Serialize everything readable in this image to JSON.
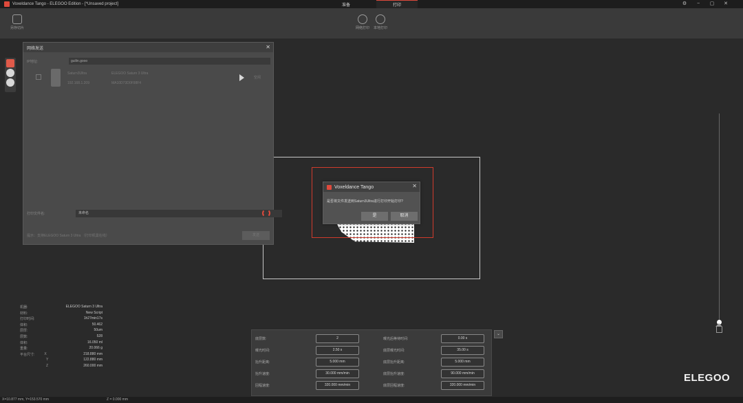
{
  "window": {
    "title": "Voxeldance Tango - ELEGOO Edition - [*Unsaved project]",
    "tabs": [
      {
        "label": "准备",
        "active": false
      },
      {
        "label": "打印",
        "active": true
      }
    ]
  },
  "toolbar": {
    "left_btn": {
      "label": "另存切片",
      "icon": "save-slice-icon"
    },
    "center_btns": [
      {
        "label": "网络打印",
        "icon": "network-print-icon"
      },
      {
        "label": "本地打印",
        "icon": "local-print-icon"
      }
    ]
  },
  "network_dialog": {
    "title": "网络发送",
    "ip_label": "IP地址:",
    "ip_value": "guilin.gooo",
    "device": {
      "name": "Saturn3Ultra",
      "model": "ELEGOO Saturn 3 Ultra",
      "ip": "192.168.1.209",
      "id": "MA10D73D0F98F4",
      "status": "空闲"
    },
    "file_label": "打印文件名:",
    "file_value": "未命名",
    "footnote": "提示：支持ELEGOO Saturn 3 Ultra   （打印机需在线）",
    "send_label": "发送"
  },
  "message_box": {
    "title": "Voxeldance Tango",
    "text": "是否将文件发送到Saturn3Ultra进行打印开始打印?",
    "yes_label": "是",
    "cancel_label": "取消"
  },
  "print_info": [
    {
      "label": "机器:",
      "value": "ELEGOO Saturn 3 Ultra"
    },
    {
      "label": "材料:",
      "value": "New Script"
    },
    {
      "label": "打印时间:",
      "value": "1h27min17s"
    },
    {
      "label": "体积:",
      "value": "50.462"
    },
    {
      "label": "层厚:",
      "value": "50um"
    },
    {
      "label": "层数:",
      "value": "528"
    },
    {
      "label": "体积:",
      "value": "16.050 ml"
    },
    {
      "label": "重量:",
      "value": "20.066 g"
    }
  ],
  "model_size": {
    "label": "平台尺寸:",
    "x": {
      "axis": "X",
      "value": "218.880 mm"
    },
    "y": {
      "axis": "Y",
      "value": "122.880 mm"
    },
    "z": {
      "axis": "Z",
      "value": "260.000 mm"
    }
  },
  "params": {
    "left": [
      {
        "label": "底层数:",
        "value": "2"
      },
      {
        "label": "曝光时间:",
        "value": "2.50 s"
      },
      {
        "label": "抬升距离:",
        "value": "5.000 mm"
      },
      {
        "label": "抬升速度:",
        "value": "30.000 mm/min"
      },
      {
        "label": "回程速度:",
        "value": "320.000 mm/min"
      }
    ],
    "right": [
      {
        "label": "曝光后等待时间:",
        "value": "0.00 s"
      },
      {
        "label": "底层曝光时间:",
        "value": "35.00 s"
      },
      {
        "label": "底层抬升距离:",
        "value": "5.000 mm"
      },
      {
        "label": "底层抬升速度:",
        "value": "90.000 mm/min"
      },
      {
        "label": "底层回程速度:",
        "value": "320.000 mm/min"
      }
    ]
  },
  "brand": "ELEGOO",
  "status": {
    "coords": "X=10.877 mm, Y=153.570 mm",
    "z": "Z = 0.000 mm"
  },
  "colors": {
    "accent": "#e04a3c",
    "highlight": "#d23b2c"
  }
}
